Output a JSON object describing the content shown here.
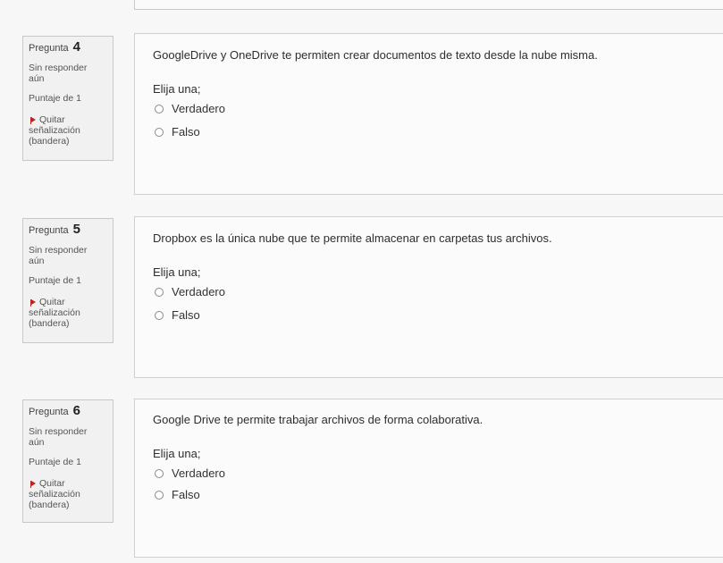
{
  "questions": [
    {
      "label": "Pregunta",
      "number": "4",
      "status_line1": "Sin responder",
      "status_line2": "aún",
      "score": "Puntaje de 1",
      "flag_line1": "Quitar",
      "flag_line2": "señalización",
      "flag_line3": "(bandera)",
      "text": "GoogleDrive y OneDrive te permiten crear documentos de texto desde la nube misma.",
      "prompt": "Elija una;",
      "options": [
        "Verdadero",
        "Falso"
      ]
    },
    {
      "label": "Pregunta",
      "number": "5",
      "status_line1": "Sin responder",
      "status_line2": "aún",
      "score": "Puntaje de 1",
      "flag_line1": "Quitar",
      "flag_line2": "señalización",
      "flag_line3": "(bandera)",
      "text": "Dropbox es la única nube que te permite almacenar en carpetas tus archivos.",
      "prompt": "Elija una;",
      "options": [
        "Verdadero",
        "Falso"
      ]
    },
    {
      "label": "Pregunta",
      "number": "6",
      "status_line1": "Sin responder",
      "status_line2": "aún",
      "score": "Puntaje de 1",
      "flag_line1": "Quitar",
      "flag_line2": "señalización",
      "flag_line3": "(bandera)",
      "text": "Google Drive te permite trabajar archivos de forma colaborativa.",
      "prompt": "Elija una;",
      "options": [
        "Verdadero",
        "Falso"
      ]
    }
  ],
  "icons": {
    "flag": "flag-icon",
    "radio": "radio-button-icon"
  },
  "colors": {
    "flag": "#bb2222",
    "border": "#c8c8c8"
  }
}
